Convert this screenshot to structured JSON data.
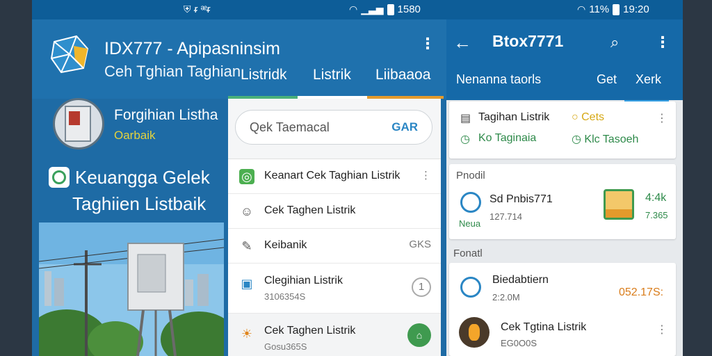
{
  "status_left": {
    "signal_text": "ᵲ ᵆᵲ"
  },
  "status_mid": {
    "time": "1580"
  },
  "status_right": {
    "signal_text": "11%",
    "time": "19:20"
  },
  "app1": {
    "title": "IDX777 - Apipasninsim",
    "subtitle": "Ceh Tghian Taghian",
    "tabs": [
      "Listridk",
      "Listrik",
      "Liibaaoa"
    ],
    "account": {
      "name": "Forgihian Listha",
      "status": "Oarbaik"
    },
    "banner": {
      "line1": "Keuangga Gelek",
      "line2": "Taghiien Listbaik"
    },
    "popup": {
      "search_placeholder": "Qek Taemacal",
      "search_action": "GAR",
      "menu": [
        {
          "label": "Keanart Cek Taghian Listrik",
          "icon": "wallet-icon"
        },
        {
          "label": "Cek Taghen Listrik",
          "icon": "user-icon"
        },
        {
          "label": "Keibanik",
          "right": "GKS",
          "icon": "edit-icon"
        },
        {
          "label": "Clegihian Listrik",
          "sub": "3106354S",
          "right": "1",
          "icon": "receipt-icon"
        },
        {
          "label": "Cek Taghen Listrik",
          "sub": "Gosu365S",
          "icon": "bolt-icon"
        }
      ]
    }
  },
  "app2": {
    "title": "Btox7771",
    "tabs": [
      "Nenanna taorls",
      "Get",
      "Xerk"
    ],
    "summary": {
      "item1": "Tagihan Listrik",
      "item1_status": "Cets",
      "item2": "Ko Taginaia",
      "item2_status": "Klc Tasoeh"
    },
    "section1": "Pnodil",
    "product": {
      "name": "Sd Pnbis771",
      "sub": "127.714",
      "tag": "Neua",
      "value": "4:4k",
      "value_sub": "7.365"
    },
    "section2": "Fonatl",
    "history": [
      {
        "name": "Biedabtiern",
        "sub": "2:2.0M",
        "amount": "052.17S:"
      },
      {
        "name": "Cek Tgtina Listrik",
        "sub": "EG0O0S"
      }
    ]
  },
  "colors": {
    "primary": "#1f71ad",
    "accent_green": "#2e8a4a",
    "accent_yellow": "#d6a814",
    "accent_orange": "#d97c1a"
  }
}
